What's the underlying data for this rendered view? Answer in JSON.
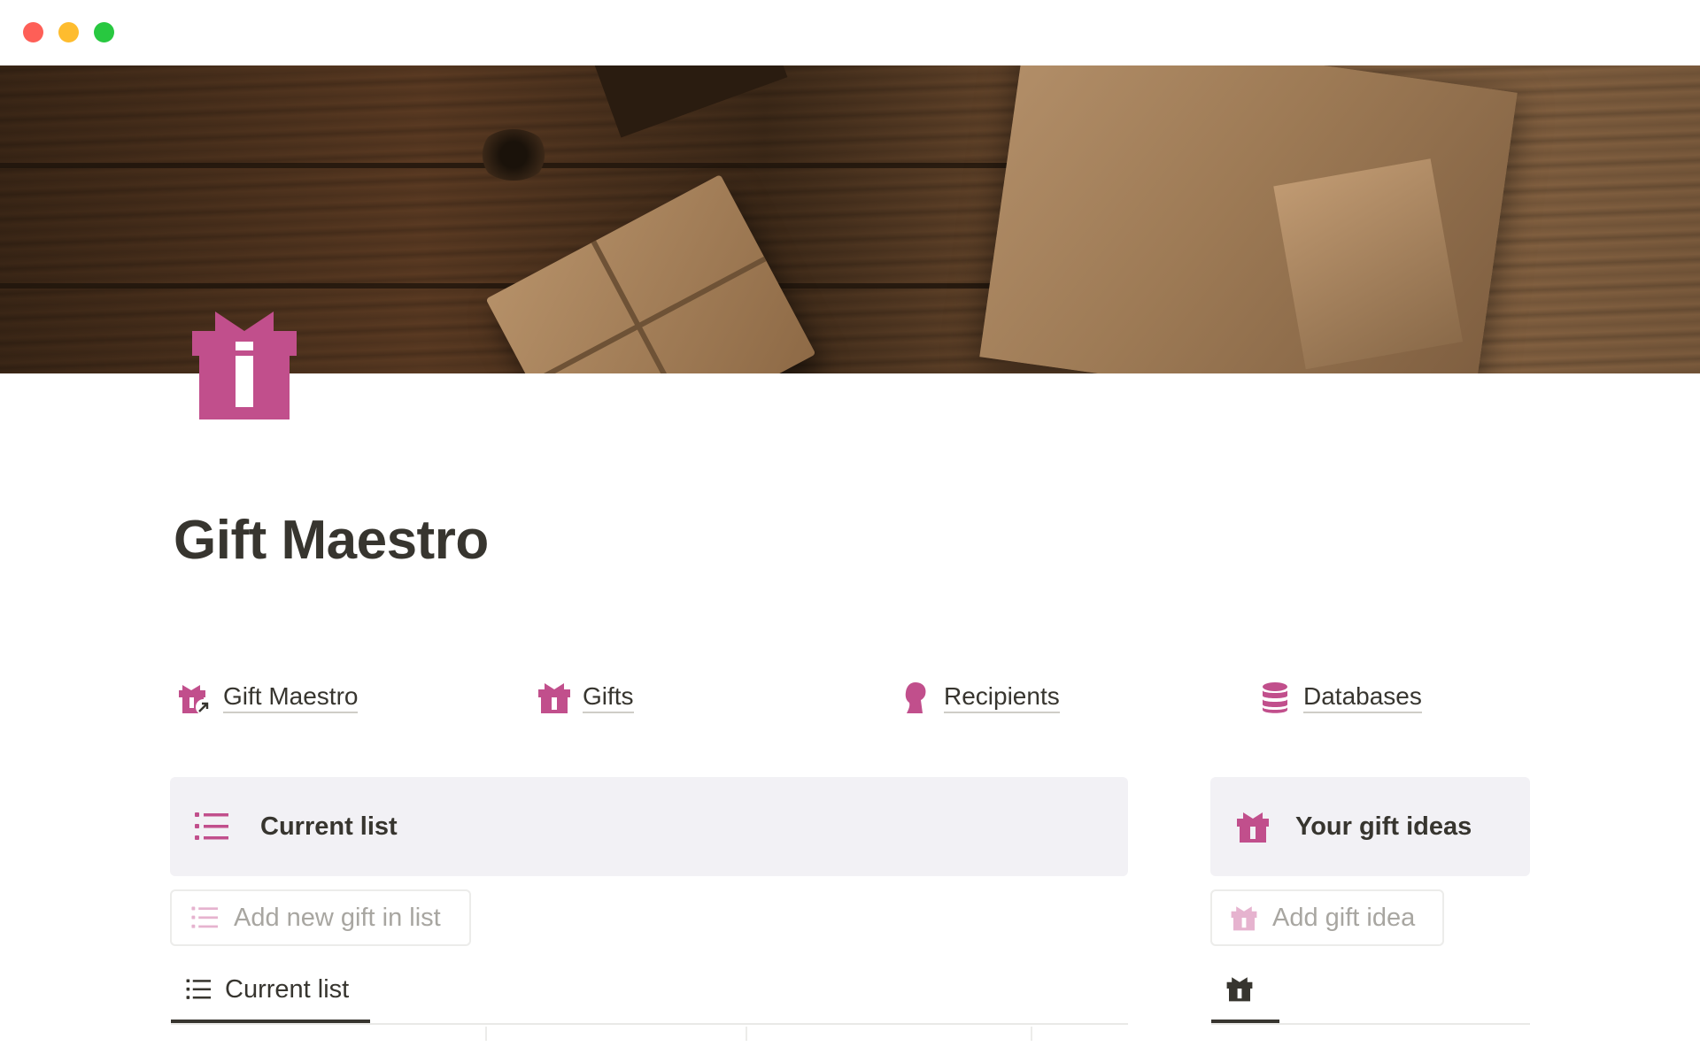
{
  "window": {
    "controls": [
      "close",
      "minimize",
      "maximize"
    ]
  },
  "page": {
    "title": "Gift Maestro",
    "icon": "gift-icon",
    "accent_color": "#c14f8c"
  },
  "nav_links": [
    {
      "label": "Gift Maestro",
      "icon": "gift-link-icon"
    },
    {
      "label": "Gifts",
      "icon": "gift-icon"
    },
    {
      "label": "Recipients",
      "icon": "person-head-icon"
    },
    {
      "label": "Databases",
      "icon": "database-icon"
    }
  ],
  "current_list": {
    "callout_title": "Current list",
    "callout_icon": "list-icon",
    "button_label": "Add new gift in list",
    "tab_label": "Current list"
  },
  "gift_ideas": {
    "callout_title": "Your gift ideas",
    "callout_icon": "gift-icon",
    "button_label": "Add gift idea",
    "tab_icon": "gift-icon"
  }
}
